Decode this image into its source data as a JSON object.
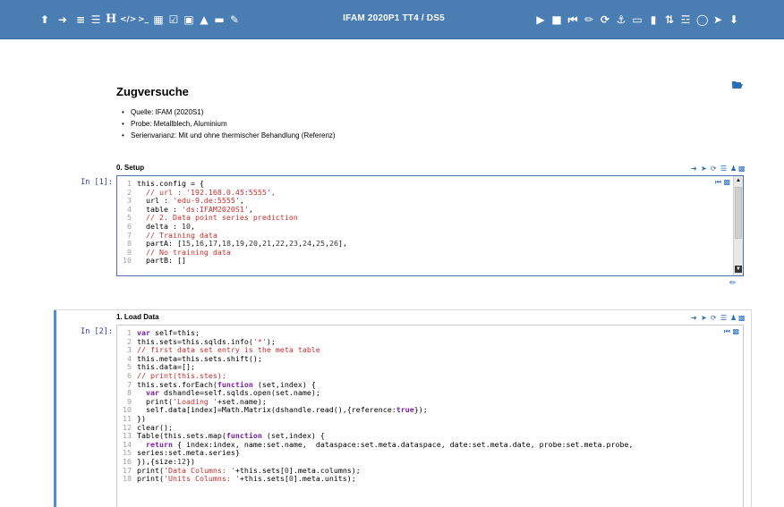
{
  "toolbar": {
    "title": "IFAM 2020P1 TT4 / DS5",
    "left_icons": [
      "upload-icon",
      "sign-in-icon",
      "list-ordered-icon",
      "list-icon",
      "heading-icon",
      "code-icon",
      "terminal-icon",
      "table-icon",
      "checkbox-icon",
      "image-icon",
      "chevron-up-icon",
      "minus-square-icon",
      "pencil-icon"
    ],
    "right_icons": [
      "play-icon",
      "stop-icon",
      "step-back-icon",
      "eraser-icon",
      "refresh-icon",
      "anchor-icon",
      "monitor-icon",
      "bookmark-icon",
      "sort-icon",
      "database-icon",
      "sitemap-icon",
      "sign-out-icon",
      "download-icon"
    ],
    "heading_glyph": "H"
  },
  "intro": {
    "heading": "Zugversuche",
    "items": [
      "Quelle: IFAM (2020S1)",
      "Probe: Metallblech, Aluminium",
      "Serienvarianz: Mit und ohne thermischer Behandlung (Referenz)"
    ]
  },
  "cell1": {
    "title": "0. Setup",
    "prompt": "In [1]:",
    "lines": [
      "this.config = {",
      "  // url : '192.168.0.45:5555',",
      "  url : 'edu-9.de:5555',",
      "  table : 'ds:IFAM2020S1',",
      "  // 2. Data point series prediction",
      "  delta : 10,",
      "  // Training data",
      "  partA: [15,16,17,18,19,20,21,22,23,24,25,26],",
      "  // No training data",
      "  partB: []"
    ]
  },
  "cell2": {
    "title": "1. Load Data",
    "prompt": "In [2]:",
    "lines": [
      "var self=this;",
      "this.sets=this.sqlds.info('*');",
      "// first data set entry is the meta table",
      "this.meta=this.sets.shift();",
      "this.data=[];",
      "// print(this.stes);",
      "this.sets.forEach(function (set,index) {",
      "  var dshandle=self.sqlds.open(set.name);",
      "  print('Loading '+set.name);",
      "  self.data[index]=Math.Matrix(dshandle.read(),{reference:true});",
      "})",
      "clear();",
      "Table(this.sets.map(function (set,index) {",
      "  return { index:index, name:set.name,  dataspace:set.meta.dataspace, date:set.meta.date, probe:set.meta.probe,",
      "series:set.meta.series}",
      "}),{size:12})",
      "print('Data Columns: '+this.sets[0].meta.columns);",
      "print('Units Columns: '+this.sets[0].meta.units);"
    ]
  },
  "colors": {
    "toolbar_bg": "#4a7eb3",
    "accent": "#2a6db5",
    "prompt": "#303f9f",
    "active_cell_bar": "#4a90d9"
  }
}
